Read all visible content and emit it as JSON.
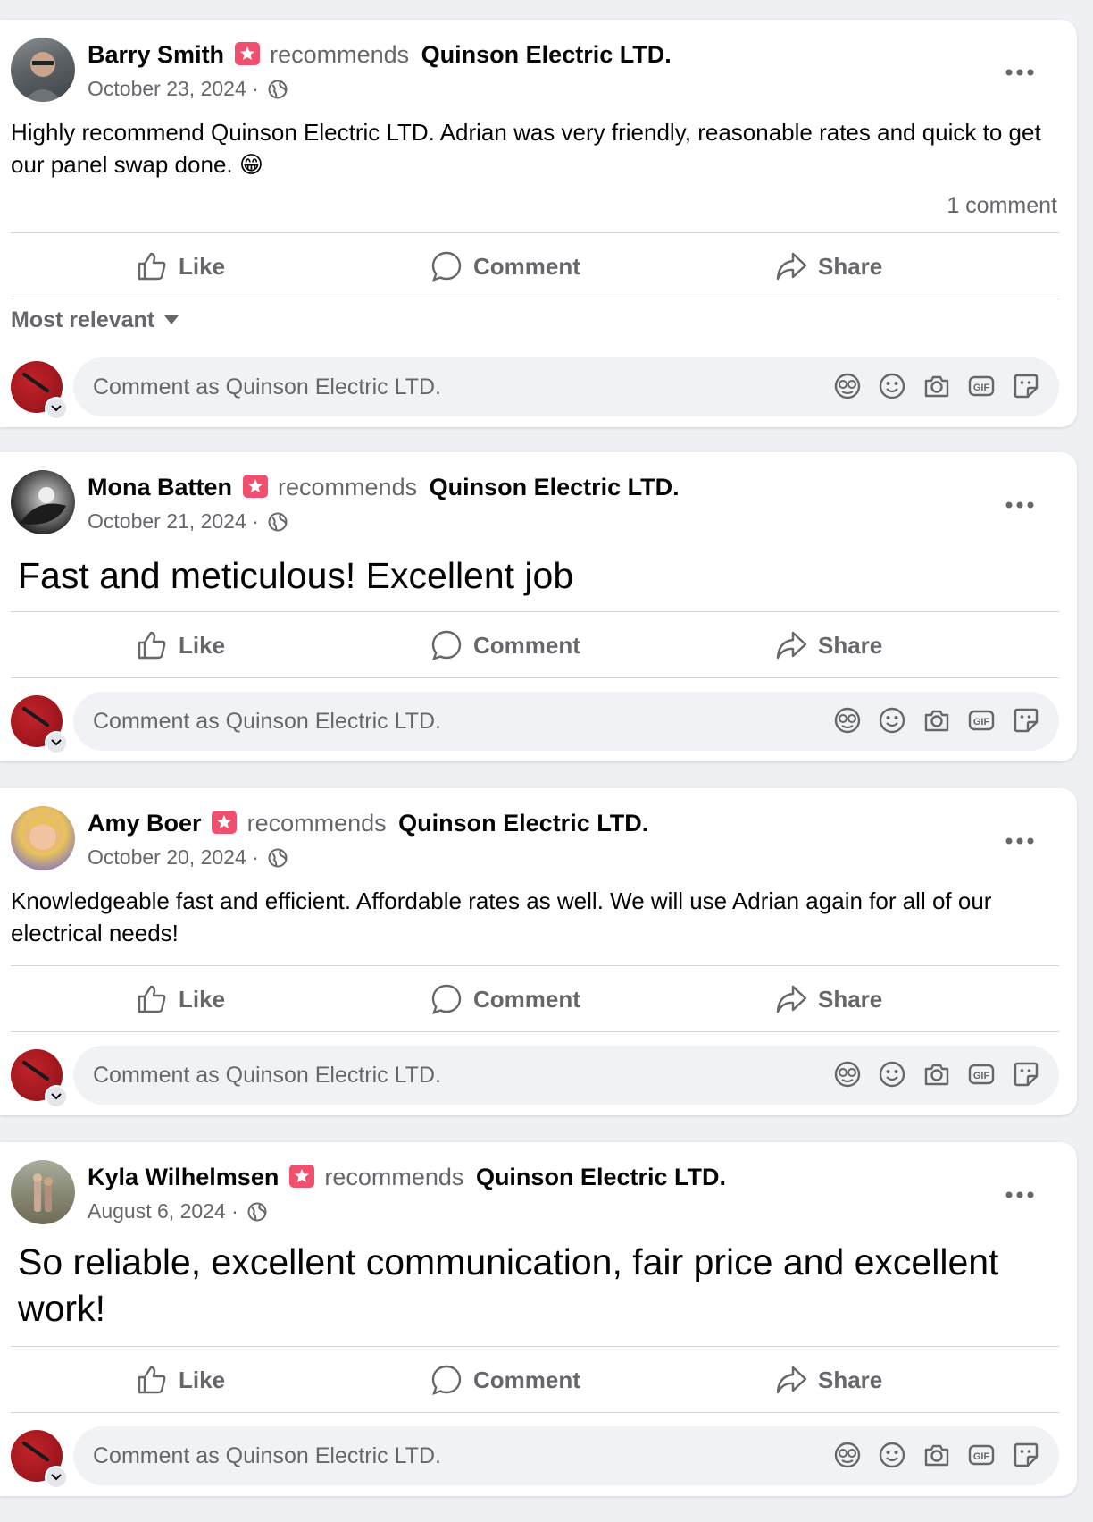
{
  "colors": {
    "page_background": "#eef0f3",
    "card_background": "#ffffff",
    "secondary_text": "#65676b",
    "recommend_badge": "#f0506e",
    "divider": "#d2d5da",
    "comment_input_bg": "#f0f2f5",
    "page_avatar": "#b01c24"
  },
  "icons": {
    "recommend": "recommend-star-badge-icon",
    "privacy": "globe-icon",
    "more": "more-horizontal-icon",
    "like": "thumbs-up-icon",
    "comment": "speech-bubble-icon",
    "share": "share-arrow-icon",
    "sort": "caret-down-icon",
    "avatar_badge": "chevron-down-icon",
    "comment_tools": [
      "avatar-sticker-icon",
      "emoji-icon",
      "camera-icon",
      "gif-icon",
      "sticker-icon"
    ]
  },
  "labels": {
    "recommends": "recommends",
    "like": "Like",
    "comment": "Comment",
    "share": "Share",
    "sort": "Most relevant",
    "comment_placeholder": "Comment as Quinson Electric LTD."
  },
  "page_name": "Quinson Electric LTD.",
  "posts": [
    {
      "author": "Barry Smith",
      "date": "October 23, 2024 ·",
      "text": "Highly recommend Quinson Electric LTD. Adrian was very friendly, reasonable rates and quick to get our panel swap done. 😁",
      "comment_count": "1 comment"
    },
    {
      "author": "Mona Batten",
      "date": "October 21, 2024 ·",
      "text": "Fast and meticulous! Excellent job"
    },
    {
      "author": "Amy Boer",
      "date": "October 20, 2024 ·",
      "text": "Knowledgeable fast and efficient. Affordable rates as well. We will use Adrian again for all of our electrical needs!"
    },
    {
      "author": "Kyla Wilhelmsen",
      "date": "August 6, 2024 ·",
      "text": "So reliable, excellent communication, fair price and excellent work!"
    }
  ]
}
